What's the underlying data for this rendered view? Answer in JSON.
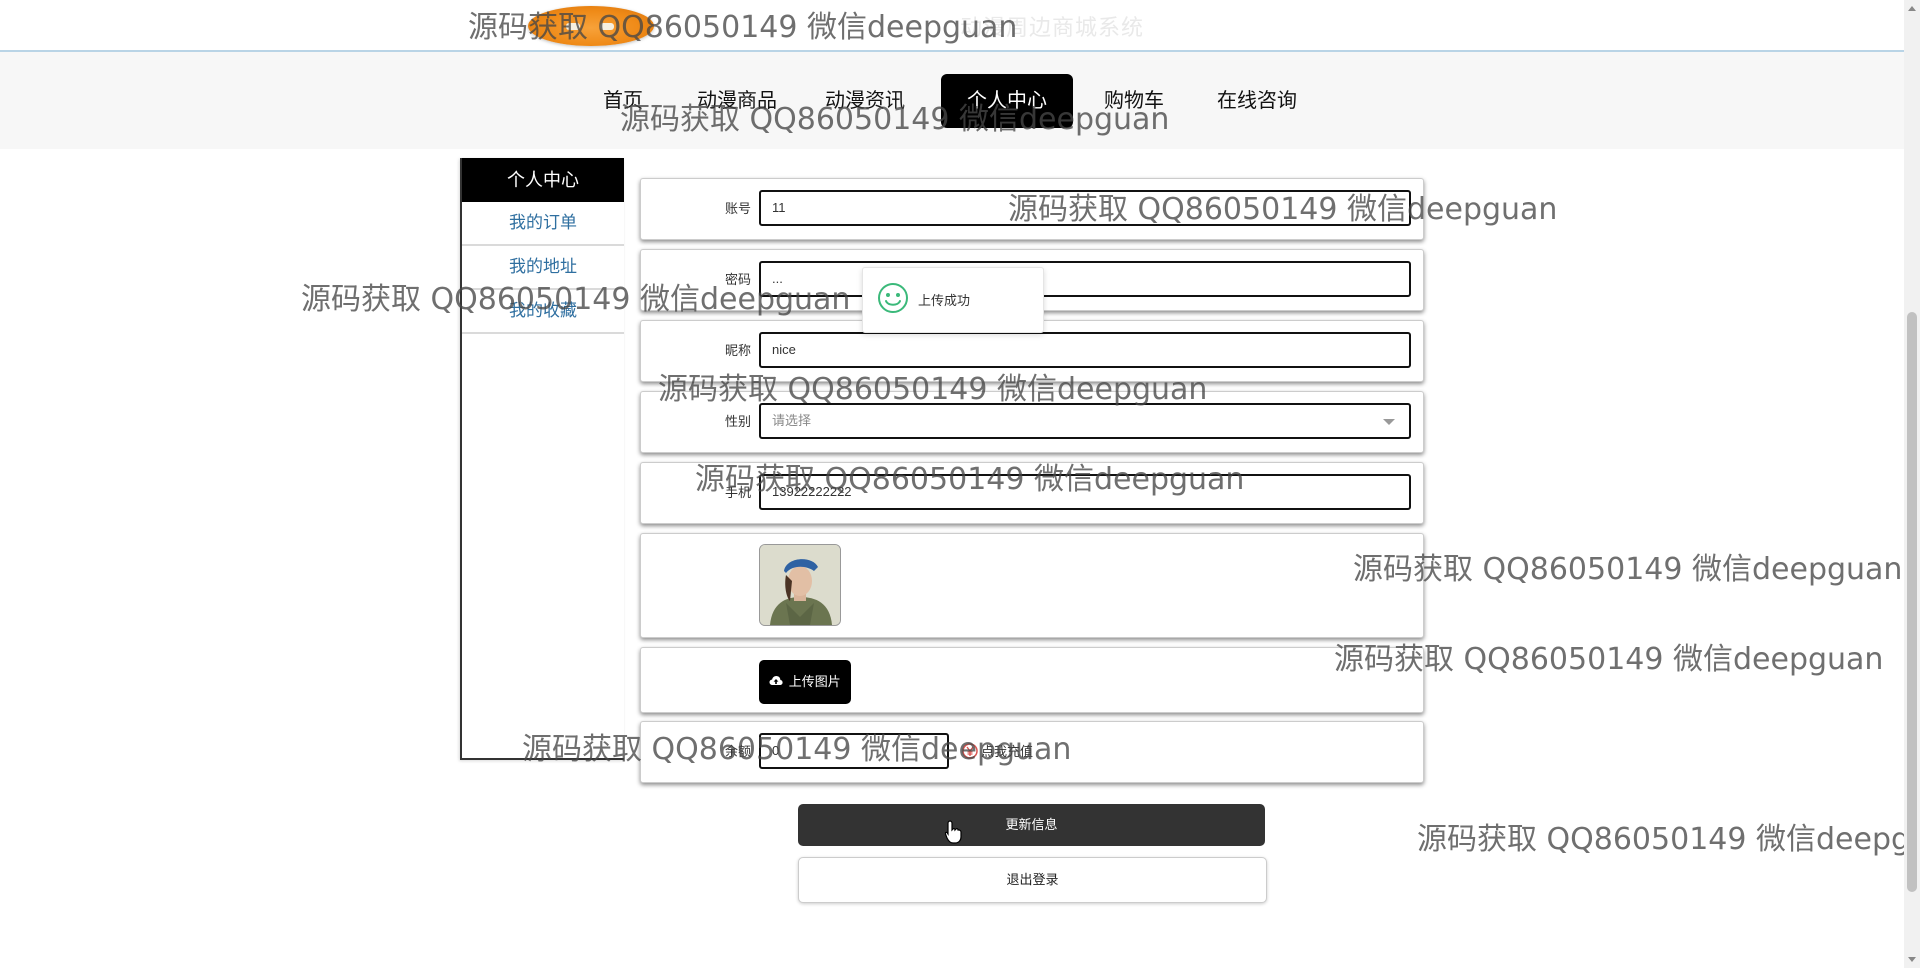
{
  "header": {
    "site_title": "动漫周边商城系统",
    "logo": "site-logo"
  },
  "nav": {
    "items": [
      {
        "label": "首页"
      },
      {
        "label": "动漫商品"
      },
      {
        "label": "动漫资讯"
      },
      {
        "label": "个人中心",
        "active": true
      },
      {
        "label": "购物车"
      },
      {
        "label": "在线咨询"
      }
    ]
  },
  "sidebar": {
    "title": "个人中心",
    "items": [
      {
        "label": "我的订单"
      },
      {
        "label": "我的地址"
      },
      {
        "label": "我的收藏"
      }
    ]
  },
  "form": {
    "account": {
      "label": "账号",
      "value": "11"
    },
    "password": {
      "label": "密码",
      "value": "..."
    },
    "nickname": {
      "label": "昵称",
      "value": "nice"
    },
    "gender": {
      "label": "性别",
      "placeholder": "请选择"
    },
    "phone": {
      "label": "手机",
      "value": "13922222222"
    },
    "upload_button": "上传图片",
    "balance": {
      "label": "余额",
      "value": "0"
    },
    "recharge_link": "点我充值",
    "update_button": "更新信息",
    "logout_button": "退出登录"
  },
  "toast": {
    "message": "上传成功",
    "icon": "smile-icon"
  },
  "watermark_text": "源码获取 QQ86050149 微信deepguan",
  "colors": {
    "accent": "#000000",
    "sidebar_link": "#2f6fa0",
    "toast_icon": "#3bb97a",
    "logo": "#ef8a17"
  }
}
